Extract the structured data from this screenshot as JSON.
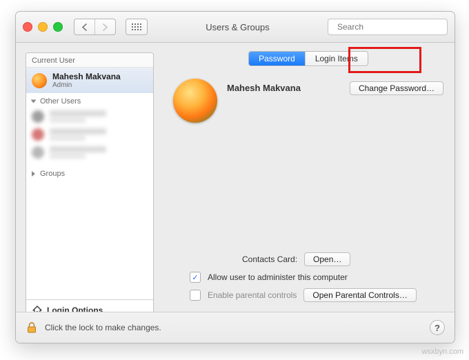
{
  "window": {
    "title": "Users & Groups"
  },
  "search": {
    "placeholder": "Search",
    "value": ""
  },
  "tabs": {
    "password": "Password",
    "login_items": "Login Items"
  },
  "sidebar": {
    "current_header": "Current User",
    "current": {
      "name": "Mahesh Makvana",
      "role": "Admin"
    },
    "other_header": "Other Users",
    "groups_header": "Groups",
    "login_options": "Login Options"
  },
  "profile": {
    "name": "Mahesh Makvana",
    "change_password": "Change Password…"
  },
  "contacts": {
    "label": "Contacts Card:",
    "open": "Open…"
  },
  "admin_check": {
    "label": "Allow user to administer this computer",
    "checked": true
  },
  "parental": {
    "label": "Enable parental controls",
    "checked": false,
    "open": "Open Parental Controls…"
  },
  "footer": {
    "lock_hint": "Click the lock to make changes."
  },
  "watermark": "wsxbyn.com"
}
